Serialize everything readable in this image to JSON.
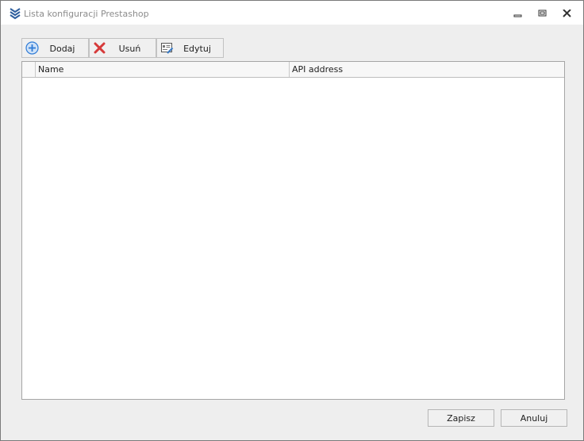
{
  "window": {
    "title": "Lista konfiguracji Prestashop",
    "title_icon": "chevrons-down-icon",
    "controls": {
      "minimize_icon": "minimize-icon",
      "restore_icon": "restore-icon",
      "close_icon": "close-icon"
    }
  },
  "toolbar": {
    "add": {
      "label": "Dodaj",
      "icon": "plus-circle-icon"
    },
    "delete": {
      "label": "Usuń",
      "icon": "red-x-icon"
    },
    "edit": {
      "label": "Edytuj",
      "icon": "edit-card-icon"
    }
  },
  "grid": {
    "columns": [
      "Name",
      "API address"
    ],
    "rows": []
  },
  "footer": {
    "save_label": "Zapisz",
    "cancel_label": "Anuluj"
  },
  "colors": {
    "title_icon": "#2f5f9e",
    "title_text": "#8c8c8c",
    "add_icon": "#2f7bd6",
    "delete_icon": "#d63a3a",
    "edit_icon": "#3b7bc4",
    "window_border": "#7a7a7a"
  }
}
